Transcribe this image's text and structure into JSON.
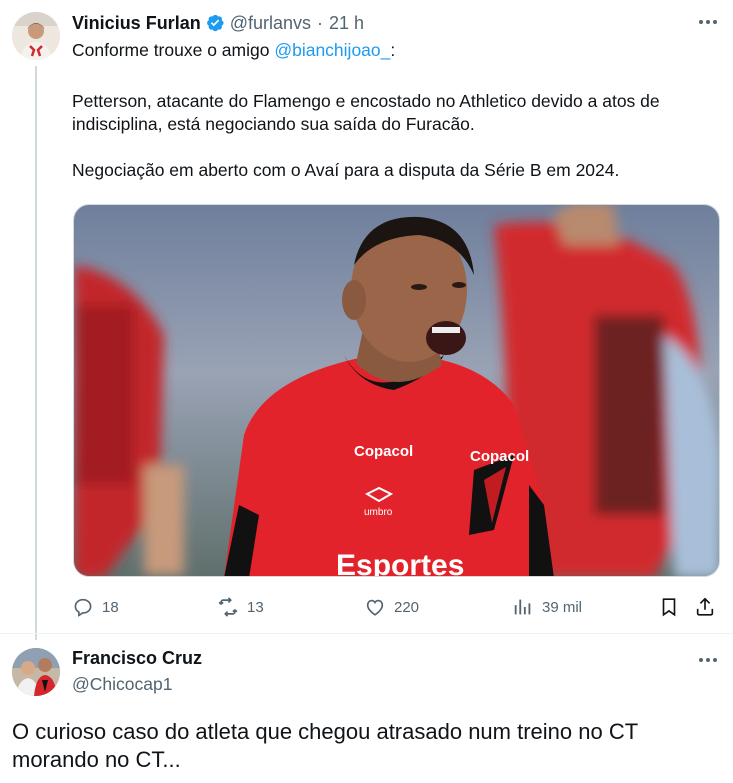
{
  "main_tweet": {
    "author_name": "Vinicius Furlan",
    "verified_icon": "verified-badge-icon",
    "author_handle": "@furlanvs",
    "separator": "·",
    "time": "21 h",
    "reply_prefix": "Conforme trouxe o amigo ",
    "reply_mention": "@bianchijoao_",
    "reply_suffix": ":",
    "paragraphs": [
      "Petterson, atacante do Flamengo e encostado no Athletico devido a atos de indisciplina, está negociando sua saída do Furacão.",
      "Negociação em aberto com o Avaí para a disputa da Série B em 2024."
    ],
    "media": {
      "shirt_sponsor_left": "Copacol",
      "shirt_sponsor_right": "Copacol",
      "shirt_brand": "umbro",
      "shirt_bottom_text": "Esportes"
    },
    "actions": {
      "replies": "18",
      "retweets": "13",
      "likes": "220",
      "views": "39 mil"
    }
  },
  "reply_tweet": {
    "author_name": "Francisco Cruz",
    "author_handle": "@Chicocap1",
    "text": "O curioso caso do atleta que chegou atrasado num treino no CT morando no CT..."
  },
  "colors": {
    "accent": "#1d9bf0",
    "secondary_text": "#536471",
    "primary_text": "#0f1419",
    "jersey_red": "#e3232b"
  }
}
